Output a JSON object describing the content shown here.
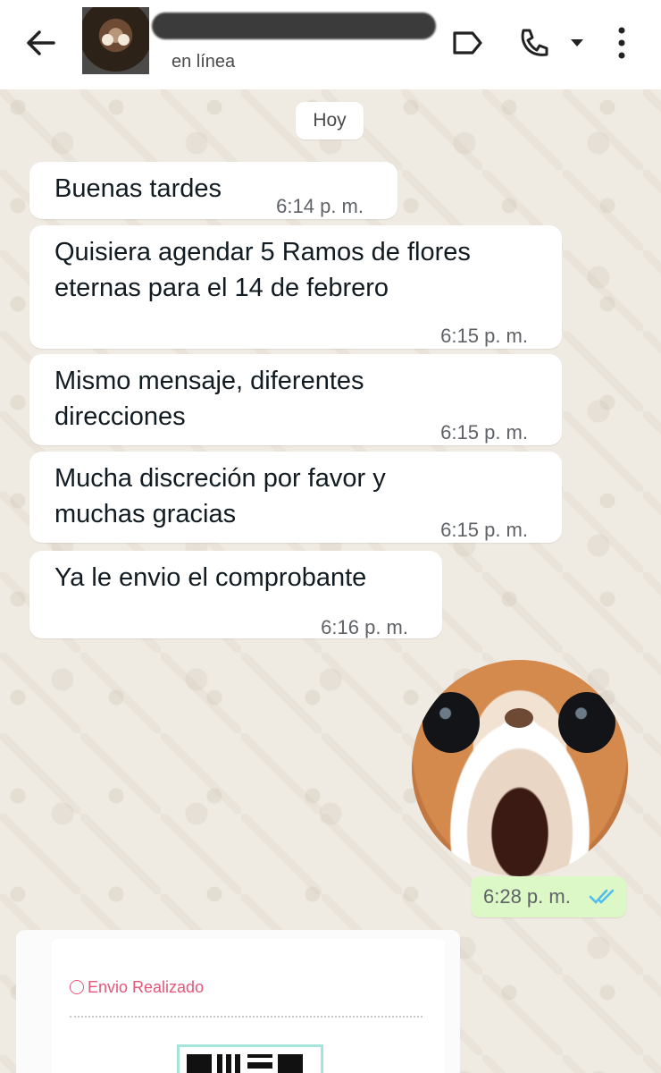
{
  "header": {
    "status": "en línea",
    "icons": [
      "arrow-back-icon",
      "label-icon",
      "phone-icon",
      "dropdown-icon",
      "more-vert-icon"
    ]
  },
  "chat": {
    "day_chip": "Hoy",
    "messages": [
      {
        "text": "Buenas tardes",
        "time": "6:14 p. m."
      },
      {
        "text": "Quisiera agendar 5 Ramos de flores eternas para el 14 de febrero",
        "time": "6:15 p. m."
      },
      {
        "text": "Mismo mensaje, diferentes direcciones",
        "time": "6:15 p. m."
      },
      {
        "text": "Mucha discreción por favor y muchas gracias",
        "time": "6:15 p. m."
      },
      {
        "text": "Ya le envio el comprobante",
        "time": "6:16 p. m."
      }
    ],
    "outgoing": {
      "time": "6:28 p. m.",
      "status": "read-double-check"
    },
    "receipt": {
      "title": "Envio Realizado"
    }
  },
  "colors": {
    "outgoing_bubble": "#dcf8c6",
    "read_ticks": "#53bdeb",
    "receipt_accent": "#e2577a"
  }
}
